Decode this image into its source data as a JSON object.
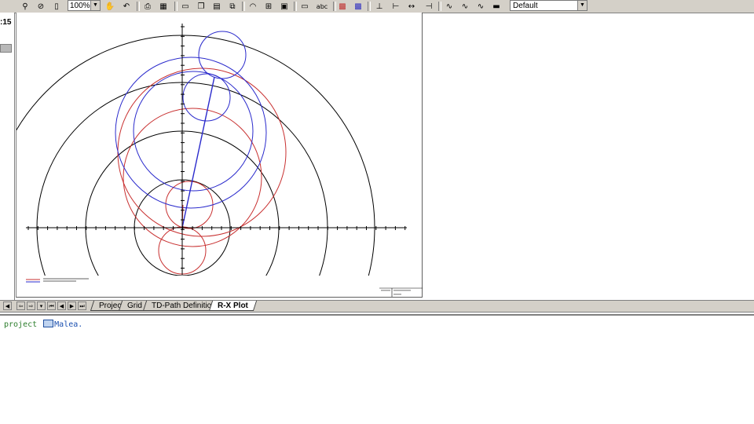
{
  "toolbar": {
    "zoom": "100%",
    "style": "Default",
    "icons": [
      "zoom-icon",
      "zoom-region-icon",
      "page-icon",
      "hand-icon",
      "undo-icon",
      "print-icon",
      "table-icon",
      "new-icon",
      "copy-icon",
      "paste-icon",
      "clone-icon",
      "signal-icon",
      "grid-icon",
      "save-icon",
      "text-icon",
      "abc-icon",
      "chart-a-icon",
      "chart-b-icon",
      "axis-a-icon",
      "axis-b-icon",
      "axis-c-icon",
      "curve-a-icon",
      "curve-b-icon",
      "curve-c-icon",
      "label-icon"
    ]
  },
  "sidebar": {
    "time": ":15"
  },
  "tabs": [
    {
      "label": "Project"
    },
    {
      "label": "Grid"
    },
    {
      "label": "TD-Path Definition"
    },
    {
      "label": "R-X Plot"
    }
  ],
  "active_tab": "R-X Plot",
  "console": {
    "keyword": "project",
    "value": "Malea."
  },
  "colors": {
    "blue_curve": "#2a2acc",
    "red_curve": "#c83030",
    "black_curve": "#000000",
    "toolbar_bg": "#d4d0c8"
  }
}
